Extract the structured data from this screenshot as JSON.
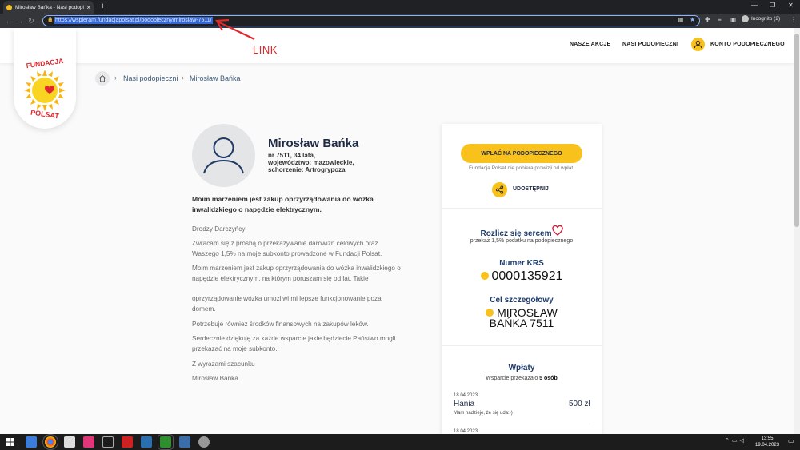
{
  "browser": {
    "tab_title": "Mirosław Bańka - Nasi podopiecz",
    "url": "https://wspieram.fundacjapolsat.pl/podopieczny/miroslaw-7511/",
    "profile_label": "Incognito (2)"
  },
  "annotation": {
    "link_label": "LINK"
  },
  "header": {
    "nav": [
      "NASZE AKCJE",
      "NASI PODOPIECZNI",
      "KONTO PODOPIECZNEGO"
    ],
    "logo_top": "FUNDACJA",
    "logo_bottom": "POLSAT"
  },
  "breadcrumb": {
    "items": [
      "Nasi podopieczni",
      "Mirosław Bańka"
    ]
  },
  "profile": {
    "name": "Mirosław Bańka",
    "meta1": "nr 7511, 34 lata,",
    "meta2": "województwo: mazowieckie,",
    "meta3": "schorzenie: Artrogrypoza",
    "dream": "Moim marzeniem jest zakup oprzyrządowania do wózka inwalidzkiego o napędzie elektrycznym.",
    "paragraphs": [
      "Drodzy Darczyńcy",
      "Zwracam się z prośbą o przekazywanie darowizn celowych oraz Waszego 1,5% na moje subkonto prowadzone w Fundacji Polsat.",
      "Moim marzeniem jest zakup oprzyrządowania do wózka inwalidzkiego o napędzie elektrycznym, na którym poruszam się od lat. Takie",
      "oprzyrządowanie wózka umożliwi mi lepsze funkcjonowanie poza domem.",
      "Potrzebuje również środków finansowych na zakupów leków.",
      "Serdecznie dziękuję za każde wsparcie jakie będziecie Państwo mogli przekazać na moje subkonto.",
      "Z wyrazami szacunku",
      "Mirosław Bańka"
    ]
  },
  "sidebar": {
    "donate_label": "WPŁAĆ NA PODOPIECZNEGO",
    "fee_note": "Fundacja Polsat nie pobiera prowizji od wpłat.",
    "share_label": "UDOSTĘPNIJ",
    "tax_title": "Rozlicz się sercem",
    "tax_sub": "przekaż 1,5% podatku na podopiecznego",
    "krs_title": "Numer KRS",
    "krs_value": "0000135921",
    "goal_title": "Cel szczegółowy",
    "goal_line1": "MIROSŁAW",
    "goal_line2": "BAŃKA 7511",
    "donations_title": "Wpłaty",
    "donations_count_prefix": "Wsparcie przekazało",
    "donations_count": "5 osób",
    "donations": [
      {
        "date": "18.04.2023",
        "name": "Hania",
        "amount": "500 zł",
        "message": "Mam nadzieję, że się uda:-)"
      },
      {
        "date": "18.04.2023"
      }
    ]
  },
  "taskbar": {
    "time": "13:55",
    "date": "19.04.2023"
  },
  "colors": {
    "accent": "#f8c11c",
    "heading": "#1c3b6b",
    "annotation": "#e02a2a"
  }
}
